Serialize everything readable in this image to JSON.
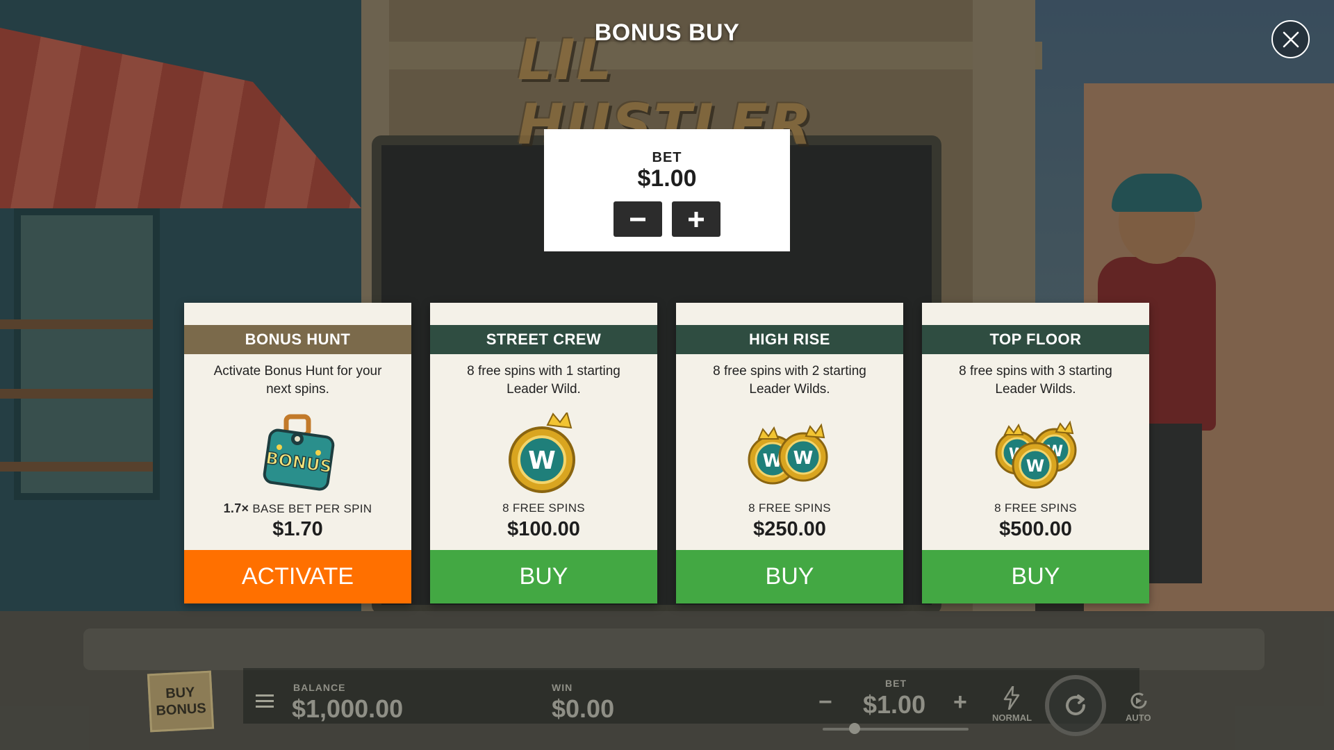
{
  "game": {
    "logo_text": "LIL HUSTLER"
  },
  "modal": {
    "title": "BONUS BUY",
    "close_icon": "close-icon",
    "bet": {
      "label": "BET",
      "value": "$1.00",
      "decrease_icon": "minus-icon",
      "increase_icon": "plus-icon"
    },
    "cards": [
      {
        "header": "BONUS HUNT",
        "description": "Activate Bonus Hunt for your next spins.",
        "icon": "bonus-bag-icon",
        "multiplier": "1.7×",
        "sub_label": "BASE BET PER SPIN",
        "price": "$1.70",
        "button": "ACTIVATE",
        "accent": "#ff7000",
        "header_color": "#7b6a4b"
      },
      {
        "header": "STREET CREW",
        "description": "8 free spins with 1 starting Leader Wild.",
        "icon": "wild-coin-icon",
        "sub_label": "8 FREE SPINS",
        "price": "$100.00",
        "button": "BUY",
        "accent": "#43a843",
        "header_color": "#2f4d41"
      },
      {
        "header": "HIGH RISE",
        "description": "8 free spins with 2 starting Leader Wilds.",
        "icon": "two-wild-coins-icon",
        "sub_label": "8 FREE SPINS",
        "price": "$250.00",
        "button": "BUY",
        "accent": "#43a843",
        "header_color": "#2f4d41"
      },
      {
        "header": "TOP FLOOR",
        "description": "8 free spins with 3 starting Leader Wilds.",
        "icon": "three-wild-coins-icon",
        "sub_label": "8 FREE SPINS",
        "price": "$500.00",
        "button": "BUY",
        "accent": "#43a843",
        "header_color": "#2f4d41"
      }
    ]
  },
  "hud": {
    "buy_bonus": "BUY\nBONUS",
    "balance_label": "BALANCE",
    "balance_value": "$1,000.00",
    "win_label": "WIN",
    "win_value": "$0.00",
    "bet_label": "BET",
    "bet_value": "$1.00",
    "speed_label": "NORMAL",
    "auto_label": "AUTO",
    "menu_icon": "hamburger-menu-icon",
    "speed_icon": "lightning-icon",
    "spin_icon": "spin-icon",
    "auto_icon": "autoplay-icon"
  }
}
